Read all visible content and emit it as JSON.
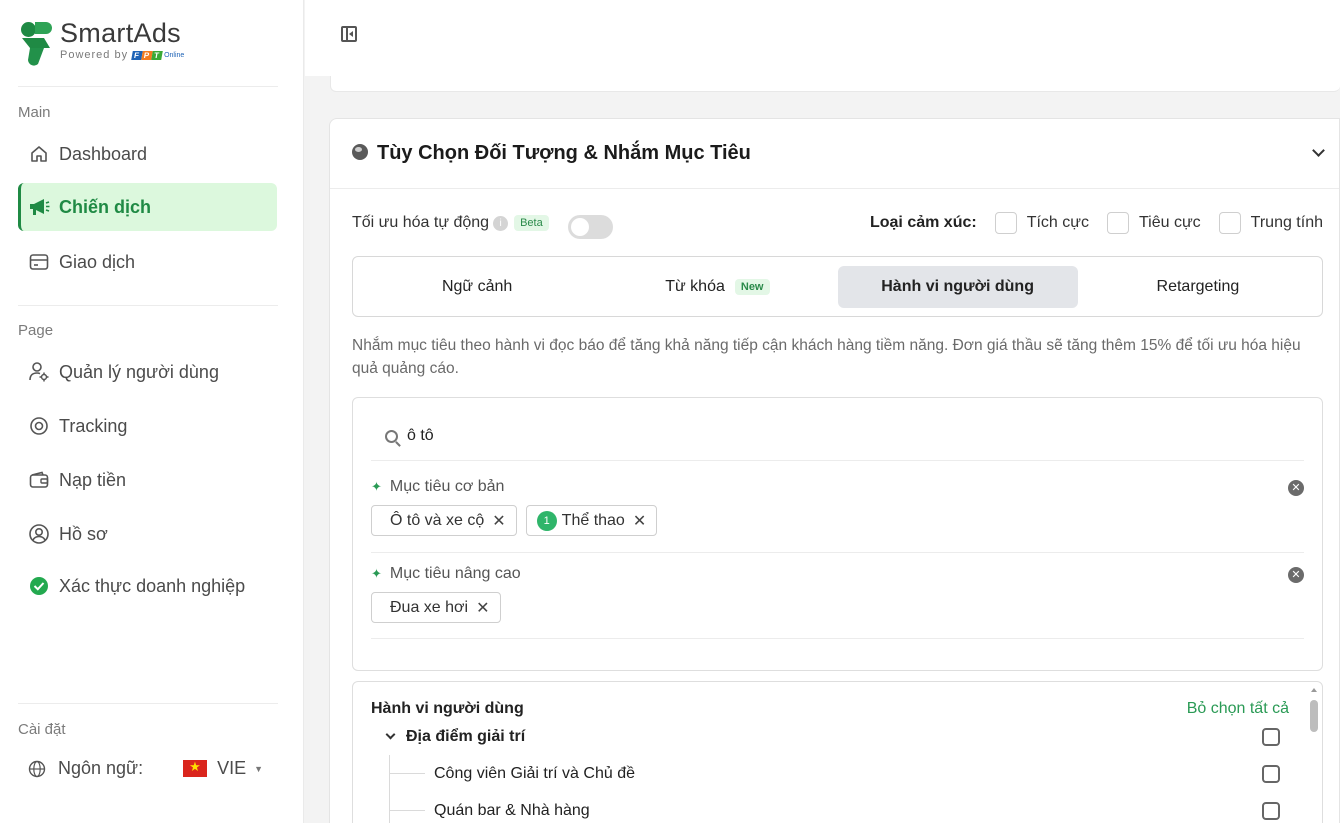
{
  "brand": {
    "name": "SmartAds",
    "powered_by": "Powered by",
    "fpt_letters": [
      "F",
      "P",
      "T"
    ],
    "fpt_online": "Online",
    "colors": {
      "green": "#1f8a44",
      "fpt_blue": "#1e63b6",
      "fpt_orange": "#f47b20",
      "fpt_green": "#3aa935"
    }
  },
  "sidebar": {
    "main_label": "Main",
    "page_label": "Page",
    "settings_label": "Cài đặt",
    "main_items": [
      {
        "label": "Dashboard",
        "icon": "home-icon"
      },
      {
        "label": "Chiến dịch",
        "icon": "megaphone-icon",
        "active": true
      },
      {
        "label": "Giao dịch",
        "icon": "card-icon"
      }
    ],
    "page_items": [
      {
        "label": "Quản lý người dùng",
        "icon": "user-gear-icon"
      },
      {
        "label": "Tracking",
        "icon": "target-icon"
      },
      {
        "label": "Nạp tiền",
        "icon": "wallet-icon"
      },
      {
        "label": "Hồ sơ",
        "icon": "profile-icon"
      },
      {
        "label": "Xác thực doanh nghiệp",
        "icon": "check-circle-icon"
      }
    ],
    "language_label": "Ngôn ngữ:",
    "language_value": "VIE"
  },
  "card": {
    "title": "Tùy Chọn Đối Tượng & Nhắm Mục Tiêu",
    "auto_opt_label": "Tối ưu hóa tự động",
    "beta": "Beta",
    "emotion_label": "Loại cảm xúc:",
    "emotions": [
      "Tích cực",
      "Tiêu cực",
      "Trung tính"
    ],
    "tabs": [
      {
        "label": "Ngữ cảnh"
      },
      {
        "label": "Từ khóa",
        "badge": "New"
      },
      {
        "label": "Hành vi người dùng",
        "active": true
      },
      {
        "label": "Retargeting"
      }
    ],
    "description": "Nhắm mục tiêu theo hành vi đọc báo để tăng khả năng tiếp cận khách hàng tiềm năng. Đơn giá thầu sẽ tăng thêm 15% để tối ưu hóa hiệu quả quảng cáo.",
    "search_value": "ô tô",
    "basic_group": {
      "title": "Mục tiêu cơ bản",
      "chips": [
        {
          "label": "Ô tô và xe cộ"
        },
        {
          "label": "Thể thao",
          "count": "1"
        }
      ]
    },
    "advanced_group": {
      "title": "Mục tiêu nâng cao",
      "chips": [
        {
          "label": "Đua xe hơi"
        }
      ]
    },
    "tree": {
      "header": "Hành vi người dùng",
      "deselect_all": "Bỏ chọn tất cả",
      "category": "Địa điểm giải trí",
      "children": [
        "Công viên Giải trí và Chủ đề",
        "Quán bar & Nhà hàng"
      ]
    }
  }
}
